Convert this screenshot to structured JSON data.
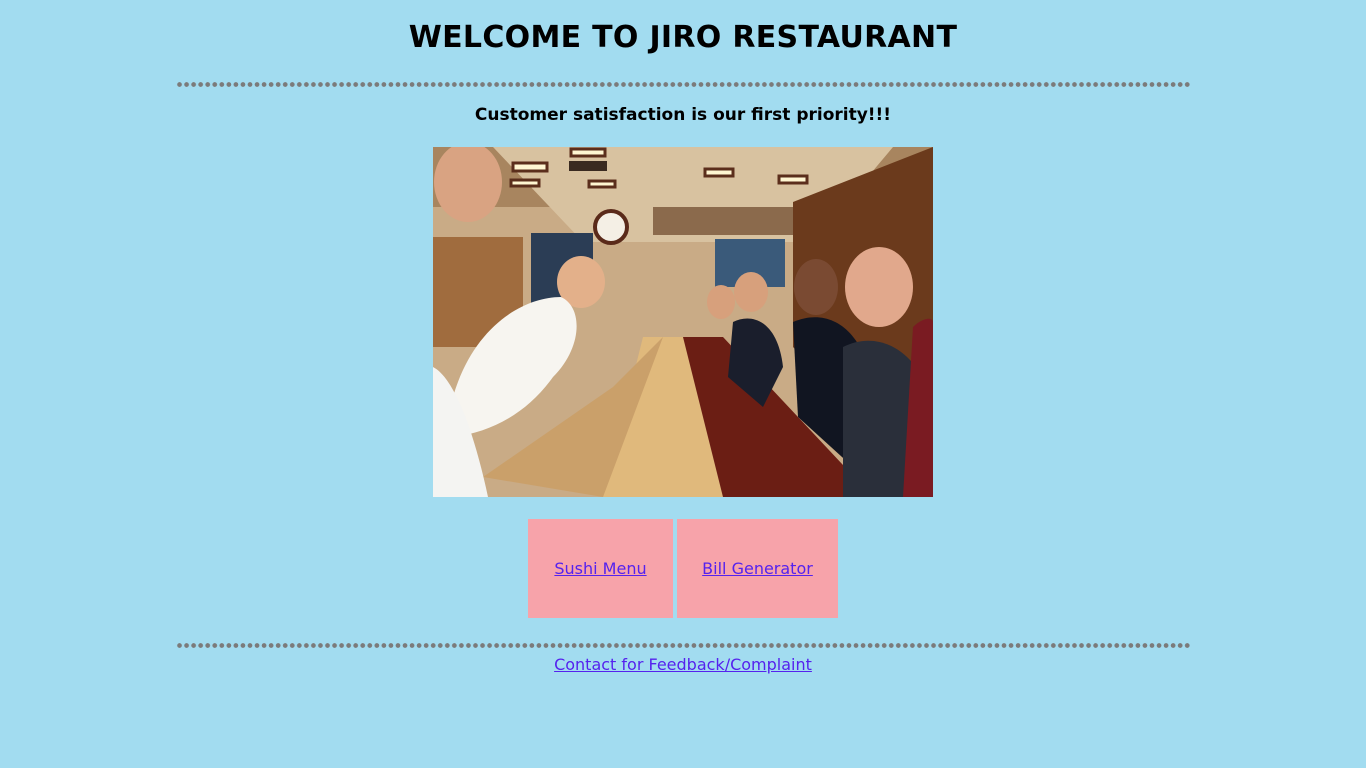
{
  "header": {
    "title": "WELCOME TO JIRO RESTAURANT",
    "tagline": "Customer satisfaction is our first priority!!!"
  },
  "hero_image": {
    "description": "sushi-counter-photo"
  },
  "nav": {
    "sushi_menu_label": "Sushi Menu",
    "bill_generator_label": "Bill Generator"
  },
  "footer": {
    "contact_label": "Contact for Feedback/Complaint"
  },
  "colors": {
    "background": "#a2dcf0",
    "nav_button": "#f7a3aa",
    "link": "#5522ee",
    "divider": "#7b7b7b"
  }
}
